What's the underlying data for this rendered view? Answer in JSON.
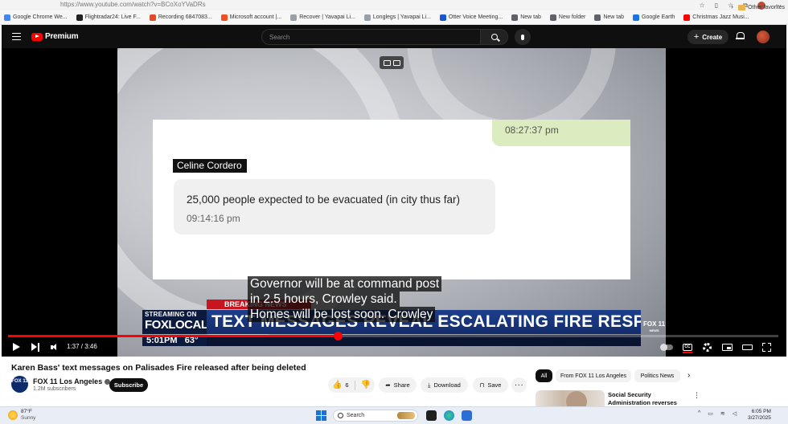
{
  "browser": {
    "url": "https://www.youtube.com/watch?v=BCoXoYVaDRs",
    "bookmarks": [
      {
        "label": "Google Chrome We...",
        "color": "#4285f4"
      },
      {
        "label": "Flightradar24: Live F...",
        "color": "#222222"
      },
      {
        "label": "Recording 6847083...",
        "color": "#e24a2c"
      },
      {
        "label": "Microsoft account |...",
        "color": "#f25022"
      },
      {
        "label": "Recover | Yavapai Li...",
        "color": "#9aa0a6"
      },
      {
        "label": "Longlegs | Yavapai Li...",
        "color": "#9aa0a6"
      },
      {
        "label": "Otter Voice Meeting...",
        "color": "#1a55d4"
      },
      {
        "label": "New tab",
        "color": "#5f6368"
      },
      {
        "label": "New folder",
        "color": "#5f6368"
      },
      {
        "label": "New tab",
        "color": "#5f6368"
      },
      {
        "label": "Google Earth",
        "color": "#1a73e8"
      },
      {
        "label": "Christmas Jazz Musi...",
        "color": "#ff0000"
      }
    ],
    "bookmarks_more": "›",
    "other_favorites": "Other favorites"
  },
  "header": {
    "brand": "Premium",
    "search_placeholder": "Search",
    "create_label": "Create",
    "create_plus": "+"
  },
  "video": {
    "message_time_top": "08:27:37 pm",
    "sender": "Celine Cordero",
    "message_text": "25,000 people expected to be evacuated (in city thus far)",
    "message_time": "09:14:16 pm",
    "breaking": "BREAKING NEWS",
    "headline": "TEXT MESSAGES REVEAL ESCALATING FIRE RESPONSE",
    "streaming_on": "STREAMING ON",
    "fox_local": "FOXLOCAL",
    "clock_time": "5:01PM",
    "temperature": "63°",
    "watermark": "FOX 11",
    "watermark_sub": "NEWS",
    "captions": [
      "Governor will be at command post",
      "in 2.5 hours, Crowley said.",
      "Homes will be lost soon. Crowley"
    ],
    "time_display": "1:37 / 3:46",
    "progress_fraction": 0.428,
    "cc_label": "CC"
  },
  "details": {
    "title": "Karen Bass' text messages on Palisades Fire released after being deleted",
    "channel_name": "FOX 11 Los Angeles",
    "channel_avatar": "FOX 11",
    "subscribers": "1.2M subscribers",
    "subscribe_label": "Subscribe",
    "likes": "6",
    "share_label": "Share",
    "download_label": "Download",
    "save_label": "Save",
    "more_label": "···"
  },
  "chips": [
    {
      "label": "All",
      "active": true
    },
    {
      "label": "From FOX 11 Los Angeles",
      "active": false
    },
    {
      "label": "Politics News",
      "active": false
    }
  ],
  "recommendation": {
    "title": "Social Security Administration reverses certain ID"
  },
  "taskbar": {
    "temperature": "87°F",
    "weather": "Sunny",
    "search_placeholder": "Search",
    "time": "6:05 PM",
    "date": "3/27/2025"
  }
}
